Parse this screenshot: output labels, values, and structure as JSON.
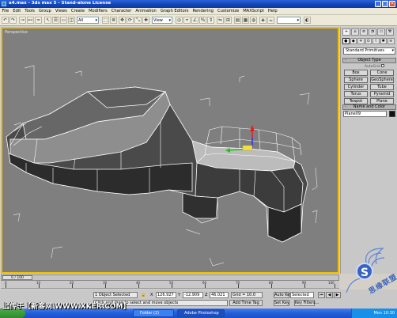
{
  "window": {
    "title": "a4.max - 3ds max 5 - Stand-alone License",
    "min_label": "_",
    "max_label": "□",
    "close_label": "×"
  },
  "menu": [
    "File",
    "Edit",
    "Tools",
    "Group",
    "Views",
    "Create",
    "Modifiers",
    "Character",
    "Animation",
    "Graph Editors",
    "Rendering",
    "Customize",
    "MAXScript",
    "Help"
  ],
  "toolbar": {
    "selection_filter": "All",
    "reference_coord": "View"
  },
  "viewport": {
    "label": "Perspective"
  },
  "command_panel": {
    "tabs": [
      "+",
      "⌂",
      "≡",
      "◔",
      "▭",
      "⚒"
    ],
    "category_icons": [
      "●",
      "◆",
      "☀",
      "⊙",
      "⌇",
      "✱",
      "≋"
    ],
    "primitive_type": "Standard Primitives",
    "object_type_header": "Object Type",
    "autogrid_label": "AutoGrid",
    "buttons": [
      "Box",
      "Cone",
      "Sphere",
      "GeoSphere",
      "Cylinder",
      "Tube",
      "Torus",
      "Pyramid",
      "Teapot",
      "Plane"
    ],
    "name_color_header": "Name and Color",
    "object_name": "Plane09"
  },
  "timeline": {
    "frame_label": "0 / 100",
    "ticks": [
      "0",
      "10",
      "20",
      "30",
      "40",
      "50",
      "60",
      "70",
      "80",
      "90",
      "100"
    ]
  },
  "status": {
    "selection_info": "1 Object Selected",
    "prompt": "Click and drag to select and move objects",
    "x_label": "X",
    "x_value": "126.927",
    "y_label": "Y",
    "y_value": "-12.909",
    "z_label": "Z",
    "z_value": "46.021",
    "grid": "Grid = 10.0",
    "add_time_tag": "Add Time Tag",
    "auto_key": "Auto Key",
    "set_key": "Set Key",
    "key_mode": "Selected",
    "key_filters": "Key Filters..."
  },
  "overlay": {
    "caption": "上传于【新客网 WWW.XKER.COM】",
    "watermark_text": "思缘联盟",
    "watermark_badge": "S"
  },
  "taskbar": {
    "items": [
      "Folder (2)",
      "Adobe Photoshop"
    ],
    "clock": "Mon 10:30"
  }
}
